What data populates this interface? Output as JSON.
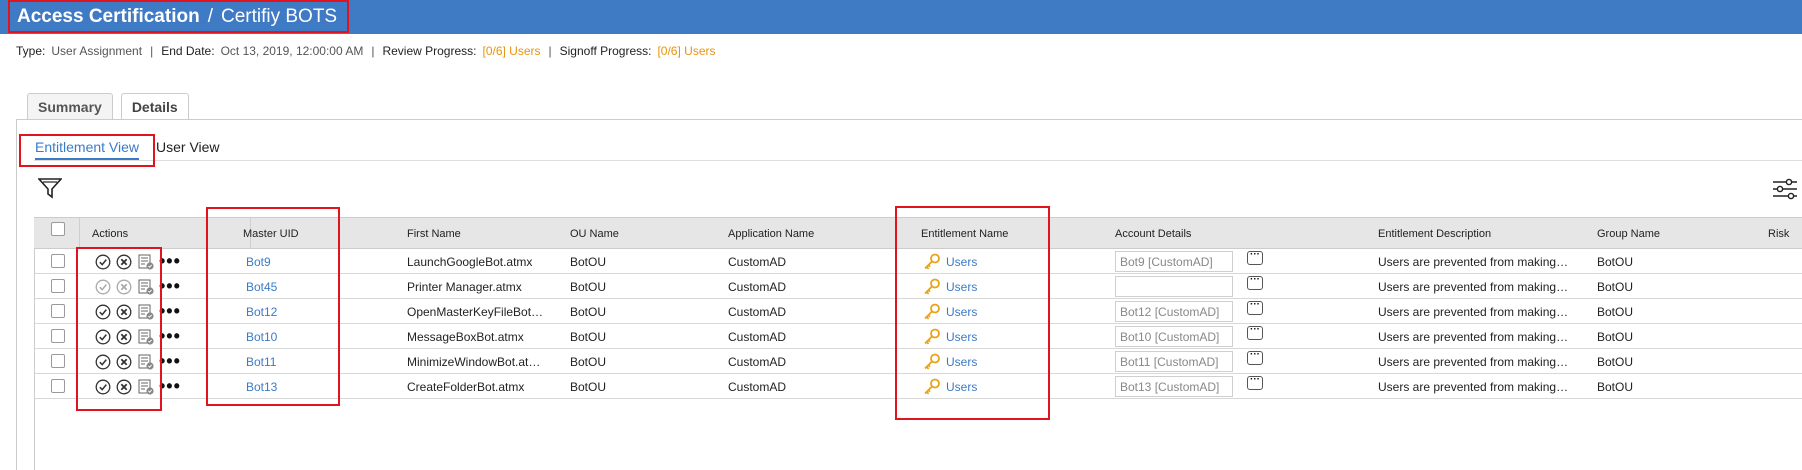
{
  "header": {
    "module": "Access Certification",
    "separator": "/",
    "name": "Certifiy BOTS"
  },
  "meta": {
    "type_label": "Type:",
    "type_value": "User Assignment",
    "end_label": "End Date:",
    "end_value": "Oct 13, 2019, 12:00:00 AM",
    "review_label": "Review Progress:",
    "review_value": "[0/6] Users",
    "signoff_label": "Signoff Progress:",
    "signoff_value": "[0/6] Users"
  },
  "tabs": {
    "summary": "Summary",
    "details": "Details"
  },
  "views": {
    "entitlement": "Entitlement View",
    "user": "User View"
  },
  "columns": {
    "actions": "Actions",
    "master_uid": "Master UID",
    "first_name": "First Name",
    "ou_name": "OU Name",
    "application_name": "Application Name",
    "entitlement_name": "Entitlement Name",
    "account_details": "Account Details",
    "entitlement_description": "Entitlement Description",
    "group_name": "Group Name",
    "risk": "Risk"
  },
  "rows": [
    {
      "uid": "Bot9",
      "first_name": "LaunchGoogleBot.atmx",
      "ou": "BotOU",
      "app": "CustomAD",
      "ent": "Users",
      "account": "Bot9 [CustomAD]",
      "desc": "Users are prevented from making…",
      "group": "BotOU",
      "actions_enabled": true
    },
    {
      "uid": "Bot45",
      "first_name": "Printer Manager.atmx",
      "ou": "BotOU",
      "app": "CustomAD",
      "ent": "Users",
      "account": "",
      "desc": "Users are prevented from making…",
      "group": "BotOU",
      "actions_enabled": false
    },
    {
      "uid": "Bot12",
      "first_name": "OpenMasterKeyFileBot…",
      "ou": "BotOU",
      "app": "CustomAD",
      "ent": "Users",
      "account": "Bot12 [CustomAD]",
      "desc": "Users are prevented from making…",
      "group": "BotOU",
      "actions_enabled": true
    },
    {
      "uid": "Bot10",
      "first_name": "MessageBoxBot.atmx",
      "ou": "BotOU",
      "app": "CustomAD",
      "ent": "Users",
      "account": "Bot10 [CustomAD]",
      "desc": "Users are prevented from making…",
      "group": "BotOU",
      "actions_enabled": true
    },
    {
      "uid": "Bot11",
      "first_name": "MinimizeWindowBot.at…",
      "ou": "BotOU",
      "app": "CustomAD",
      "ent": "Users",
      "account": "Bot11 [CustomAD]",
      "desc": "Users are prevented from making…",
      "group": "BotOU",
      "actions_enabled": true
    },
    {
      "uid": "Bot13",
      "first_name": "CreateFolderBot.atmx",
      "ou": "BotOU",
      "app": "CustomAD",
      "ent": "Users",
      "account": "Bot13 [CustomAD]",
      "desc": "Users are prevented from making…",
      "group": "BotOU",
      "actions_enabled": true
    }
  ],
  "more_glyph": "•••",
  "ellipsis_btn": "···",
  "colors": {
    "header_bg": "#3f7ac5",
    "link": "#3a7bc8",
    "progress": "#e8940c",
    "annotation": "#e0141e",
    "key": "#e8a317"
  },
  "icons": {
    "filter": "filter-icon",
    "settings": "sliders-icon",
    "approve": "check-circle-icon",
    "revoke": "x-circle-icon",
    "details": "list-check-icon",
    "entitlement": "key-icon"
  }
}
